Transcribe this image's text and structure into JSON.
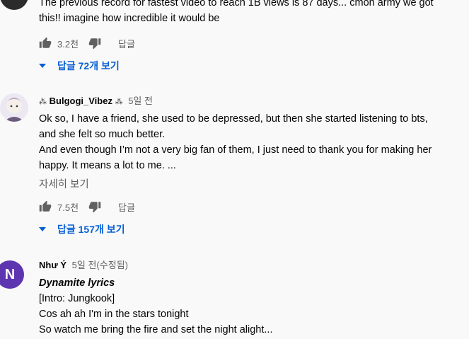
{
  "comment1": {
    "lines": [
      "The previous record for fastest video to reach 1B views is 87 days... cmon army we got",
      "this!! imagine how incredible it would be"
    ],
    "likes": "3.2천",
    "reply_label": "답글",
    "replies_toggle": "답글 72개 보기"
  },
  "comment2": {
    "author": "Bulgogi_Vibez",
    "time": "5일 전",
    "lines": [
      "Ok so, I have a friend, she used to be depressed, but then she started listening to bts,",
      "and she felt so much better.",
      "And even though I’m not a very big fan of them, I just need to thank you for making her",
      "happy. It means a lot to me. ..."
    ],
    "read_more": "자세히 보기",
    "likes": "7.5천",
    "reply_label": "답글",
    "replies_toggle": "답글 157개 보기"
  },
  "comment3": {
    "author": "Như Ý",
    "time": "5일 전(수정됨)",
    "avatar_letter": "N",
    "avatar_color": "#5e35b1",
    "title_line": "Dynamite lyrics",
    "lines": [
      "[Intro: Jungkook]",
      "Cos ah ah I'm in the stars tonight",
      "So watch me bring the fire and set the night alight..."
    ]
  },
  "colors": {
    "link_blue": "#065fd4",
    "secondary_text": "#606060"
  }
}
